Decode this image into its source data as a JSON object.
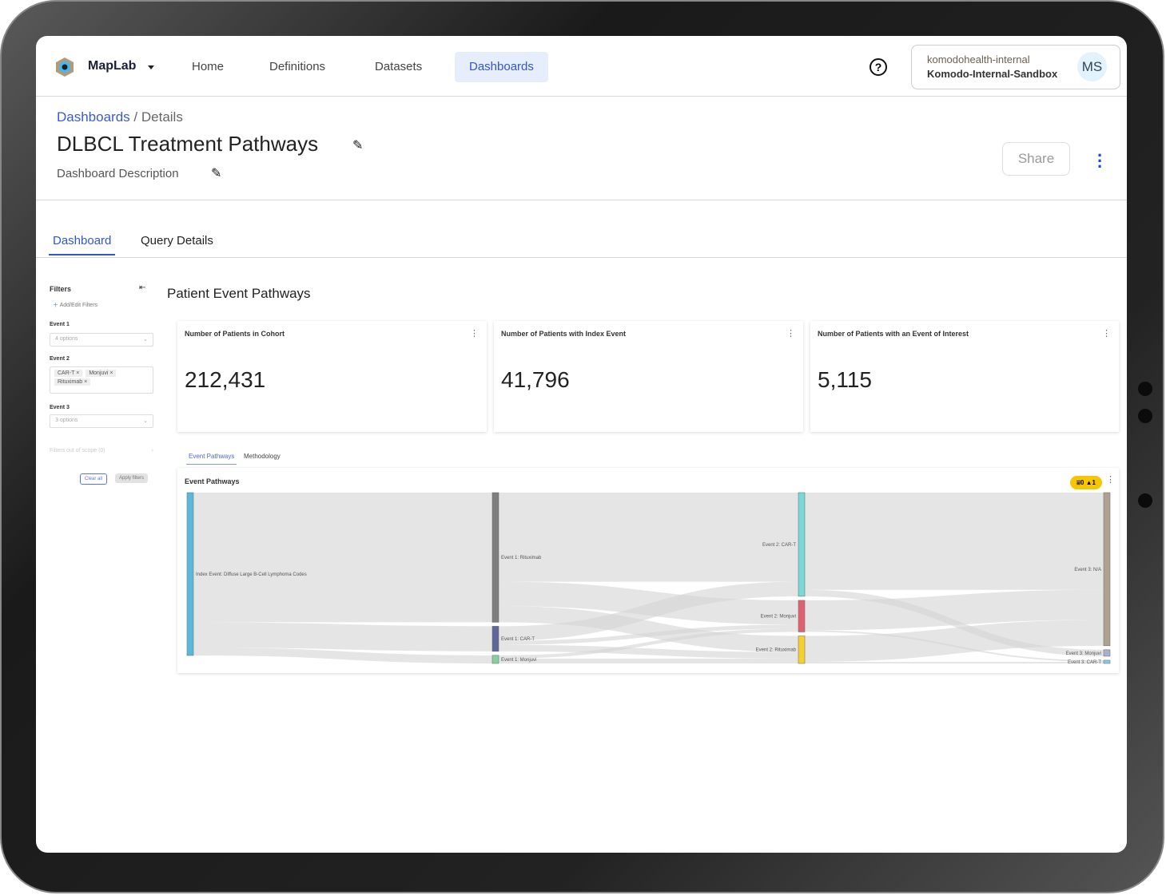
{
  "app": {
    "brand": "MapLab"
  },
  "nav": [
    {
      "label": "Home"
    },
    {
      "label": "Definitions"
    },
    {
      "label": "Datasets"
    },
    {
      "label": "Dashboards",
      "active": true
    }
  ],
  "account": {
    "org": "komodohealth-internal",
    "workspace": "Komodo-Internal-Sandbox",
    "initials": "MS"
  },
  "breadcrumb": {
    "parent": "Dashboards",
    "separator": "/",
    "current": "Details"
  },
  "page": {
    "title": "DLBCL Treatment Pathways",
    "description": "Dashboard Description",
    "share_label": "Share"
  },
  "tabs": [
    {
      "label": "Dashboard",
      "active": true
    },
    {
      "label": "Query Details"
    }
  ],
  "filters": {
    "title": "Filters",
    "add_label": "Add/Edit Filters",
    "event1": {
      "label": "Event 1",
      "value": "4 options"
    },
    "event2": {
      "label": "Event 2",
      "chips": [
        "CAR-T",
        "Monjuvi",
        "Rituximab"
      ]
    },
    "event3": {
      "label": "Event 3",
      "value": "3 options"
    },
    "out_of_scope": "Filters out of scope (0)",
    "clear_label": "Clear all",
    "apply_label": "Apply filters"
  },
  "section_title": "Patient Event Pathways",
  "metrics": [
    {
      "title": "Number of Patients in Cohort",
      "value": "212,431"
    },
    {
      "title": "Number of Patients with Index Event",
      "value": "41,796"
    },
    {
      "title": "Number of Patients with an Event of Interest",
      "value": "5,115"
    }
  ],
  "chart_tabs": [
    {
      "label": "Event Pathways",
      "active": true
    },
    {
      "label": "Methodology"
    }
  ],
  "chart_data": {
    "type": "sankey",
    "title": "Event Pathways",
    "badge": {
      "filters": "0",
      "warnings": "1"
    },
    "nodes": [
      {
        "id": "idx",
        "label": "Index Event: Diffuse Large B-Cell Lymphoma Codes",
        "col": 0,
        "color": "#5bb8d8"
      },
      {
        "id": "e1r",
        "label": "Event 1: Rituximab",
        "col": 1,
        "color": "#7f7f7f"
      },
      {
        "id": "e1c",
        "label": "Event 1: CAR-T",
        "col": 1,
        "color": "#5f6699"
      },
      {
        "id": "e1m",
        "label": "Event 1: Monjuvi",
        "col": 1,
        "color": "#86d0a0"
      },
      {
        "id": "e2c",
        "label": "Event 2: CAR-T",
        "col": 2,
        "color": "#79d9d6"
      },
      {
        "id": "e2m",
        "label": "Event 2: Monjuvi",
        "col": 2,
        "color": "#e06070"
      },
      {
        "id": "e2r",
        "label": "Event 2: Rituximab",
        "col": 2,
        "color": "#f5d130"
      },
      {
        "id": "e3n",
        "label": "Event 3: N/A",
        "col": 3,
        "color": "#b0a290"
      },
      {
        "id": "e3m",
        "label": "Event 3: Monjuvi",
        "col": 3,
        "color": "#aab0cc"
      },
      {
        "id": "e3c",
        "label": "Event 3: CAR-T",
        "col": 3,
        "color": "#88c8e8"
      }
    ],
    "links": [
      {
        "s": "idx",
        "t": "e1r",
        "v": 160
      },
      {
        "s": "idx",
        "t": "e1c",
        "v": 31
      },
      {
        "s": "idx",
        "t": "e1m",
        "v": 10
      },
      {
        "s": "e1r",
        "t": "e2c",
        "v": 110
      },
      {
        "s": "e1r",
        "t": "e2m",
        "v": 30
      },
      {
        "s": "e1r",
        "t": "e2r",
        "v": 20
      },
      {
        "s": "e1c",
        "t": "e2c",
        "v": 18
      },
      {
        "s": "e1c",
        "t": "e2m",
        "v": 5
      },
      {
        "s": "e1c",
        "t": "e2r",
        "v": 8
      },
      {
        "s": "e1m",
        "t": "e2m",
        "v": 4
      },
      {
        "s": "e1m",
        "t": "e2r",
        "v": 6
      },
      {
        "s": "e2c",
        "t": "e3n",
        "v": 120
      },
      {
        "s": "e2c",
        "t": "e3m",
        "v": 8
      },
      {
        "s": "e2m",
        "t": "e3n",
        "v": 37
      },
      {
        "s": "e2m",
        "t": "e3c",
        "v": 2
      },
      {
        "s": "e2r",
        "t": "e3n",
        "v": 32
      },
      {
        "s": "e2r",
        "t": "e3c",
        "v": 2
      }
    ]
  }
}
